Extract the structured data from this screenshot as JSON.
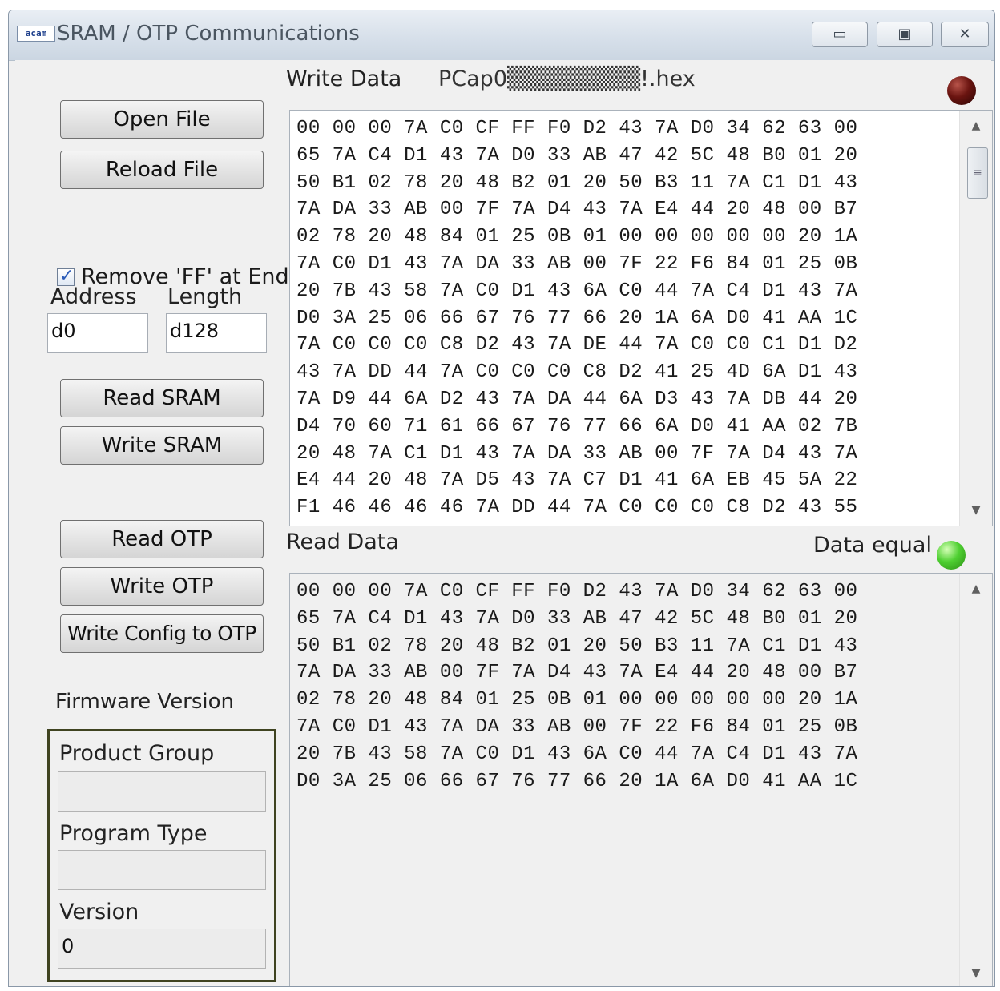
{
  "window": {
    "title": "SRAM / OTP Communications",
    "app_icon_text": "acam",
    "controls": {
      "minimize": "▭",
      "maximize": "▣",
      "close": "✕"
    }
  },
  "buttons": {
    "open_file": "Open File",
    "reload_file": "Reload File",
    "read_sram": "Read SRAM",
    "write_sram": "Write SRAM",
    "read_otp": "Read OTP",
    "write_otp": "Write OTP",
    "write_config_otp": "Write Config to OTP"
  },
  "remove_ff": {
    "label": "Remove 'FF' at End",
    "checked": true
  },
  "address": {
    "label": "Address",
    "value": "d0"
  },
  "length": {
    "label": "Length",
    "value": "d128"
  },
  "firmware": {
    "title": "Firmware Version",
    "product_group": {
      "label": "Product Group",
      "value": ""
    },
    "program_type": {
      "label": "Program Type",
      "value": ""
    },
    "version": {
      "label": "Version",
      "value": "0"
    }
  },
  "write_data": {
    "label": "Write Data",
    "filename": "PCap0▒▒▒▒▒▒▒▒!.hex",
    "led_color": "#5a0d0a",
    "lines": [
      "00 00 00 7A C0 CF FF F0 D2 43 7A D0 34 62 63 00",
      "65 7A C4 D1 43 7A D0 33 AB 47 42 5C 48 B0 01 20",
      "50 B1 02 78 20 48 B2 01 20 50 B3 11 7A C1 D1 43",
      "7A DA 33 AB 00 7F 7A D4 43 7A E4 44 20 48 00 B7",
      "02 78 20 48 84 01 25 0B 01 00 00 00 00 00 20 1A",
      "7A C0 D1 43 7A DA 33 AB 00 7F 22 F6 84 01 25 0B",
      "20 7B 43 58 7A C0 D1 43 6A C0 44 7A C4 D1 43 7A",
      "D0 3A 25 06 66 67 76 77 66 20 1A 6A D0 41 AA 1C",
      "7A C0 C0 C0 C8 D2 43 7A DE 44 7A C0 C0 C1 D1 D2",
      "43 7A DD 44 7A C0 C0 C0 C8 D2 41 25 4D 6A D1 43",
      "7A D9 44 6A D2 43 7A DA 44 6A D3 43 7A DB 44 20",
      "D4 70 60 71 61 66 67 76 77 66 6A D0 41 AA 02 7B",
      "20 48 7A C1 D1 43 7A DA 33 AB 00 7F 7A D4 43 7A",
      "E4 44 20 48 7A D5 43 7A C7 D1 41 6A EB 45 5A 22",
      "F1 46 46 46 46 7A DD 44 7A C0 C0 C0 C8 D2 43 55"
    ]
  },
  "read_data": {
    "label": "Read Data",
    "status": "Data equal",
    "led_color": "#3cc020",
    "lines": [
      "00 00 00 7A C0 CF FF F0 D2 43 7A D0 34 62 63 00",
      "65 7A C4 D1 43 7A D0 33 AB 47 42 5C 48 B0 01 20",
      "50 B1 02 78 20 48 B2 01 20 50 B3 11 7A C1 D1 43",
      "7A DA 33 AB 00 7F 7A D4 43 7A E4 44 20 48 00 B7",
      "02 78 20 48 84 01 25 0B 01 00 00 00 00 00 20 1A",
      "7A C0 D1 43 7A DA 33 AB 00 7F 22 F6 84 01 25 0B",
      "20 7B 43 58 7A C0 D1 43 6A C0 44 7A C4 D1 43 7A",
      "D0 3A 25 06 66 67 76 77 66 20 1A 6A D0 41 AA 1C"
    ]
  },
  "scroll": {
    "up": "▲",
    "down": "▼",
    "grip": "≡"
  }
}
